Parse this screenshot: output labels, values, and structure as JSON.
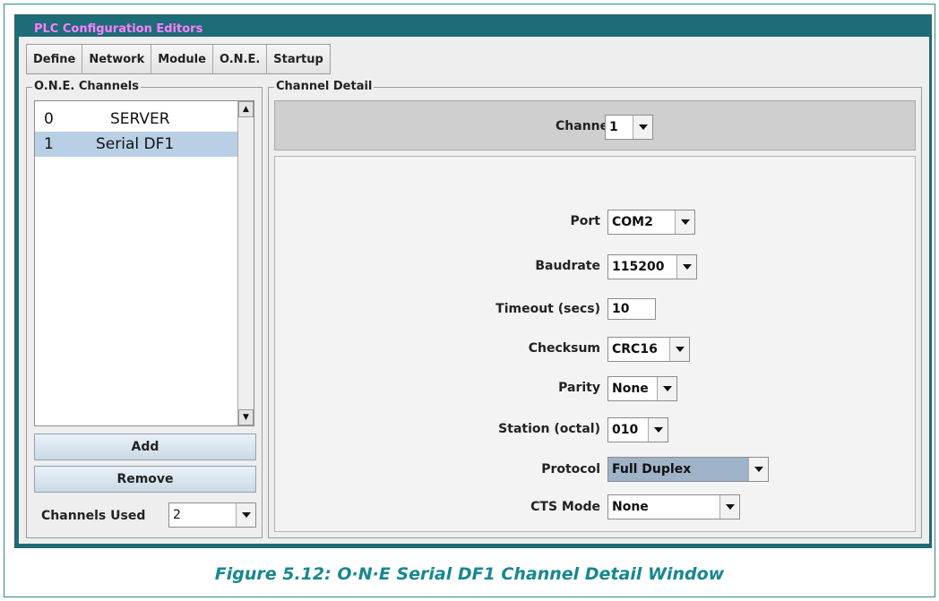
{
  "window": {
    "title": "PLC Configuration Editors"
  },
  "toolbar": {
    "tabs": [
      "Define",
      "Network",
      "Module",
      "O.N.E.",
      "Startup"
    ]
  },
  "channels_panel": {
    "title": "O.N.E. Channels",
    "items": [
      {
        "num": "0",
        "name": "SERVER",
        "selected": false
      },
      {
        "num": "1",
        "name": "Serial DF1",
        "selected": true
      }
    ],
    "add_label": "Add",
    "remove_label": "Remove",
    "channels_used_label": "Channels Used",
    "channels_used_value": "2"
  },
  "detail_panel": {
    "title": "Channel Detail",
    "channel_label": "Channel",
    "channel_value": "1",
    "fields": {
      "port": {
        "label": "Port",
        "value": "COM2"
      },
      "baudrate": {
        "label": "Baudrate",
        "value": "115200"
      },
      "timeout": {
        "label": "Timeout (secs)",
        "value": "10"
      },
      "checksum": {
        "label": "Checksum",
        "value": "CRC16"
      },
      "parity": {
        "label": "Parity",
        "value": "None"
      },
      "station": {
        "label": "Station (octal)",
        "value": "010"
      },
      "protocol": {
        "label": "Protocol",
        "value": "Full Duplex"
      },
      "cts_mode": {
        "label": "CTS Mode",
        "value": "None"
      }
    }
  },
  "caption": "Figure 5.12: O·N·E Serial DF1 Channel Detail Window",
  "colors": {
    "window_frame": "#1d6c78",
    "title_text": "#ff7fff",
    "selection": "#b8cfe5",
    "protocol_highlight": "#9fb3c8",
    "caption_text": "#17878f"
  },
  "icons": {
    "dropdown": "chevron-down-icon",
    "scroll_up": "scroll-up-icon",
    "scroll_down": "scroll-down-icon"
  }
}
